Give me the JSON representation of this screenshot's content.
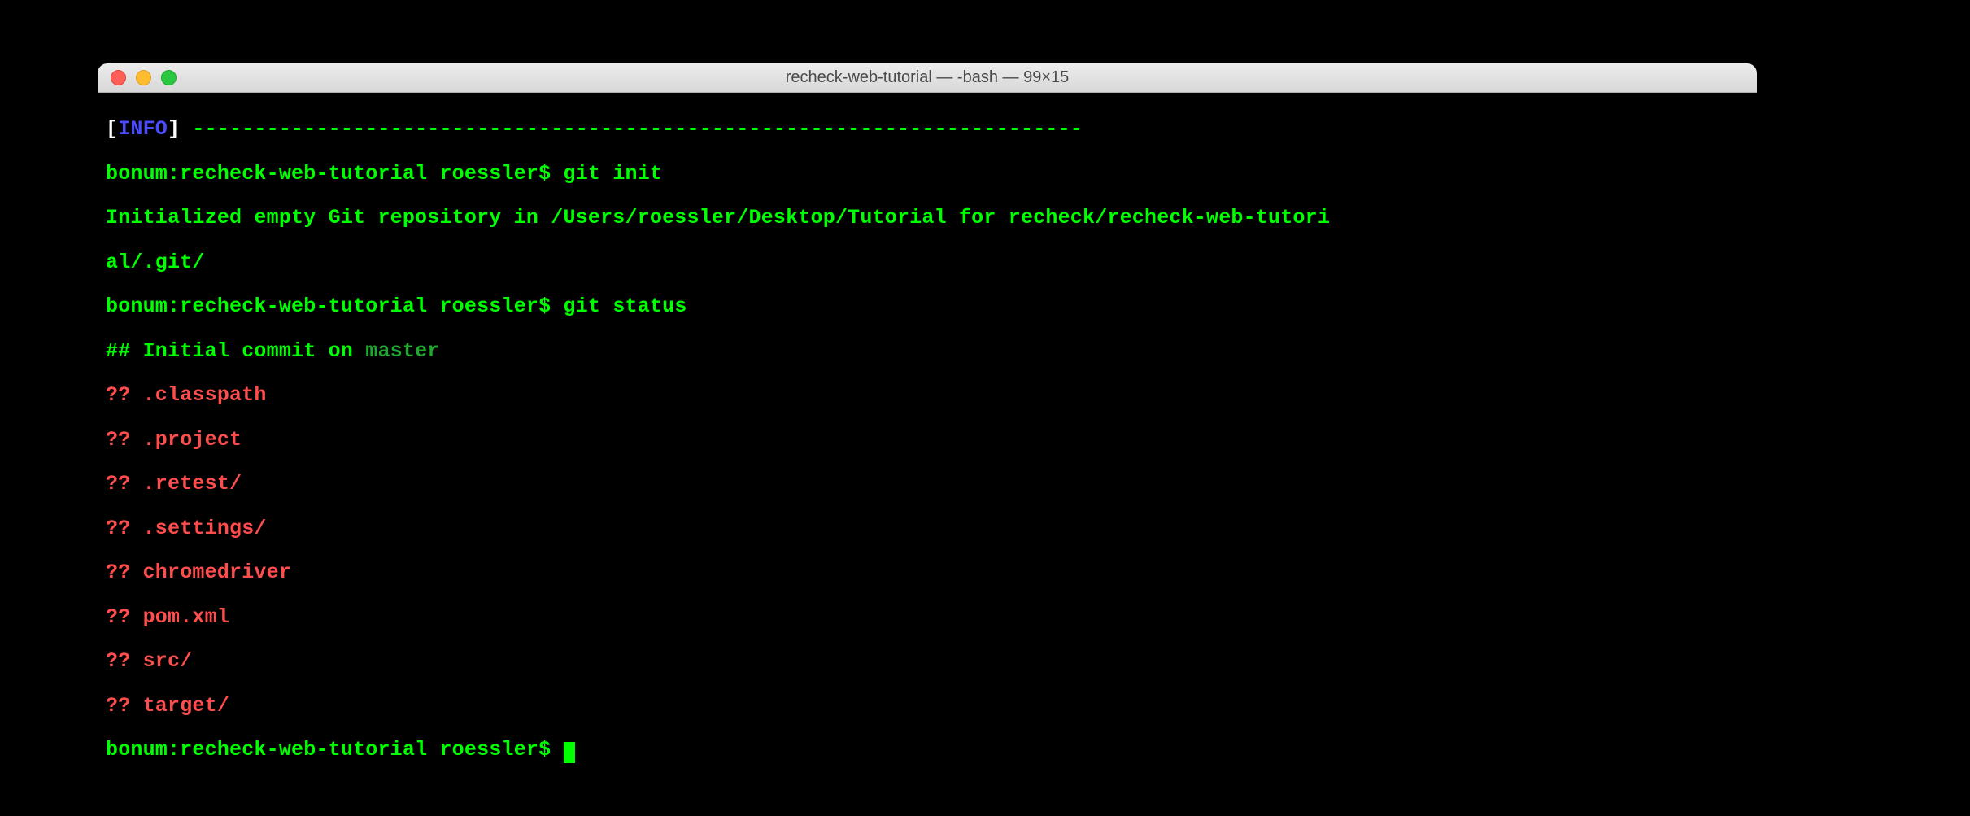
{
  "window": {
    "title": "recheck-web-tutorial — -bash — 99×15"
  },
  "colors": {
    "term_green": "#00ff00",
    "term_red": "#ff4d4d",
    "term_blue": "#4a4aff",
    "term_dimgreen": "#1fa72f",
    "term_white": "#ffffff",
    "bg": "#000000"
  },
  "prompt": {
    "host": "bonum",
    "dir": "recheck-web-tutorial",
    "user": "roessler",
    "symbol": "$"
  },
  "info": {
    "label": "INFO",
    "bracket_open": "[",
    "bracket_close": "]",
    "dashes": "------------------------------------------------------------------------"
  },
  "cmd1": "git init",
  "output1_line1": "Initialized empty Git repository in /Users/roessler/Desktop/Tutorial for recheck/recheck-web-tutori",
  "output1_line2": "al/.git/",
  "cmd2": "git status",
  "status_header_prefix": "## Initial commit on ",
  "status_header_branch": "master",
  "untracked_prefix": "?? ",
  "untracked": [
    ".classpath",
    ".project",
    ".retest/",
    ".settings/",
    "chromedriver",
    "pom.xml",
    "src/",
    "target/"
  ]
}
